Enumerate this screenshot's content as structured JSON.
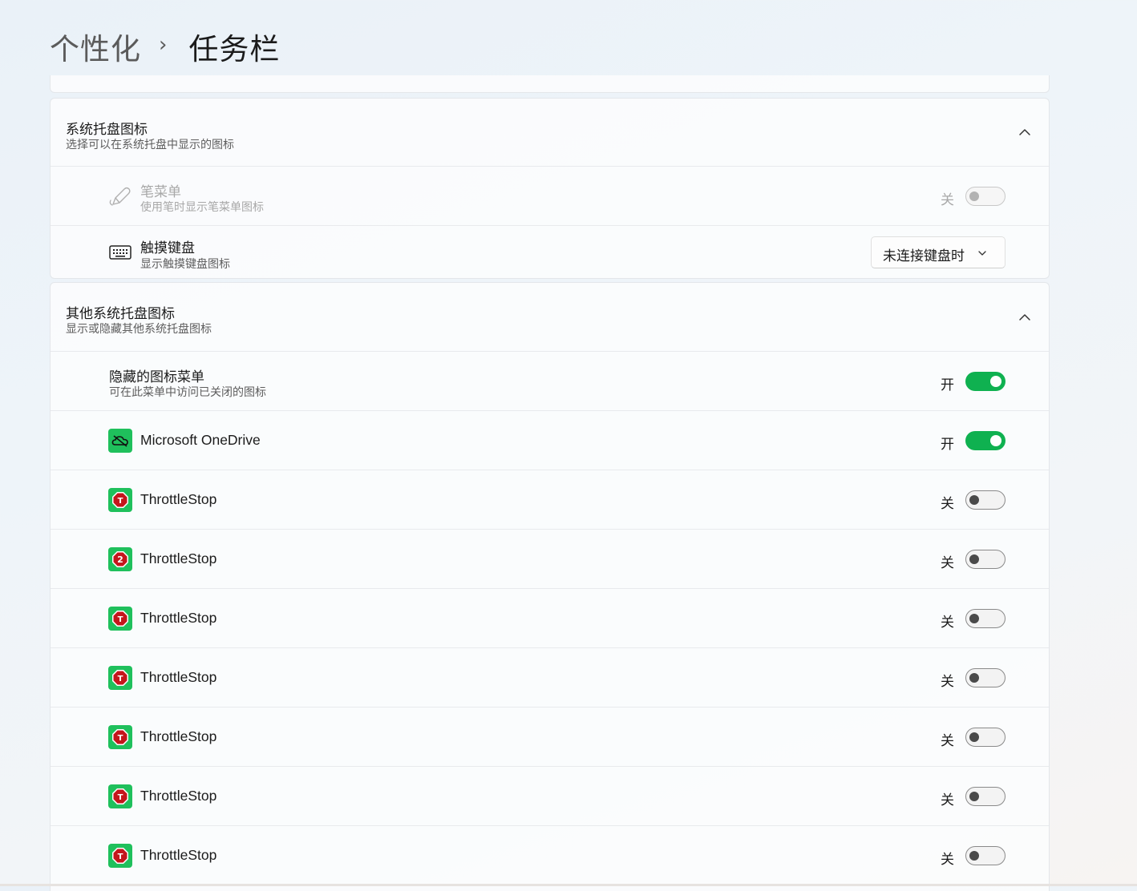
{
  "breadcrumb": {
    "parent": "个性化",
    "separator": "›",
    "current": "任务栏"
  },
  "system_tray": {
    "title": "系统托盘图标",
    "subtitle": "选择可以在系统托盘中显示的图标",
    "items": [
      {
        "title": "笔菜单",
        "subtitle": "使用笔时显示笔菜单图标",
        "state": "关",
        "icon": "pen-icon",
        "disabled": true
      },
      {
        "title": "触摸键盘",
        "subtitle": "显示触摸键盘图标",
        "dropdown_value": "未连接键盘时",
        "icon": "keyboard-icon"
      }
    ]
  },
  "other_tray": {
    "title": "其他系统托盘图标",
    "subtitle": "显示或隐藏其他系统托盘图标",
    "hidden_menu": {
      "title": "隐藏的图标菜单",
      "subtitle": "可在此菜单中访问已关闭的图标",
      "state": "开"
    },
    "apps": [
      {
        "name": "Microsoft OneDrive",
        "state": "开",
        "icon": "onedrive-icon"
      },
      {
        "name": "ThrottleStop",
        "state": "关",
        "icon": "throttlestop-icon",
        "glyph": "T"
      },
      {
        "name": "ThrottleStop",
        "state": "关",
        "icon": "throttlestop-icon",
        "glyph": "2"
      },
      {
        "name": "ThrottleStop",
        "state": "关",
        "icon": "throttlestop-icon",
        "glyph": "T"
      },
      {
        "name": "ThrottleStop",
        "state": "关",
        "icon": "throttlestop-icon",
        "glyph": "T"
      },
      {
        "name": "ThrottleStop",
        "state": "关",
        "icon": "throttlestop-icon",
        "glyph": "T"
      },
      {
        "name": "ThrottleStop",
        "state": "关",
        "icon": "throttlestop-icon",
        "glyph": "T"
      },
      {
        "name": "ThrottleStop",
        "state": "关",
        "icon": "throttlestop-icon",
        "glyph": "T"
      }
    ]
  },
  "colors": {
    "accent": "#0fb150",
    "app_icon_bg": "#1fc05c",
    "throttlestop_red": "#c4161c"
  }
}
